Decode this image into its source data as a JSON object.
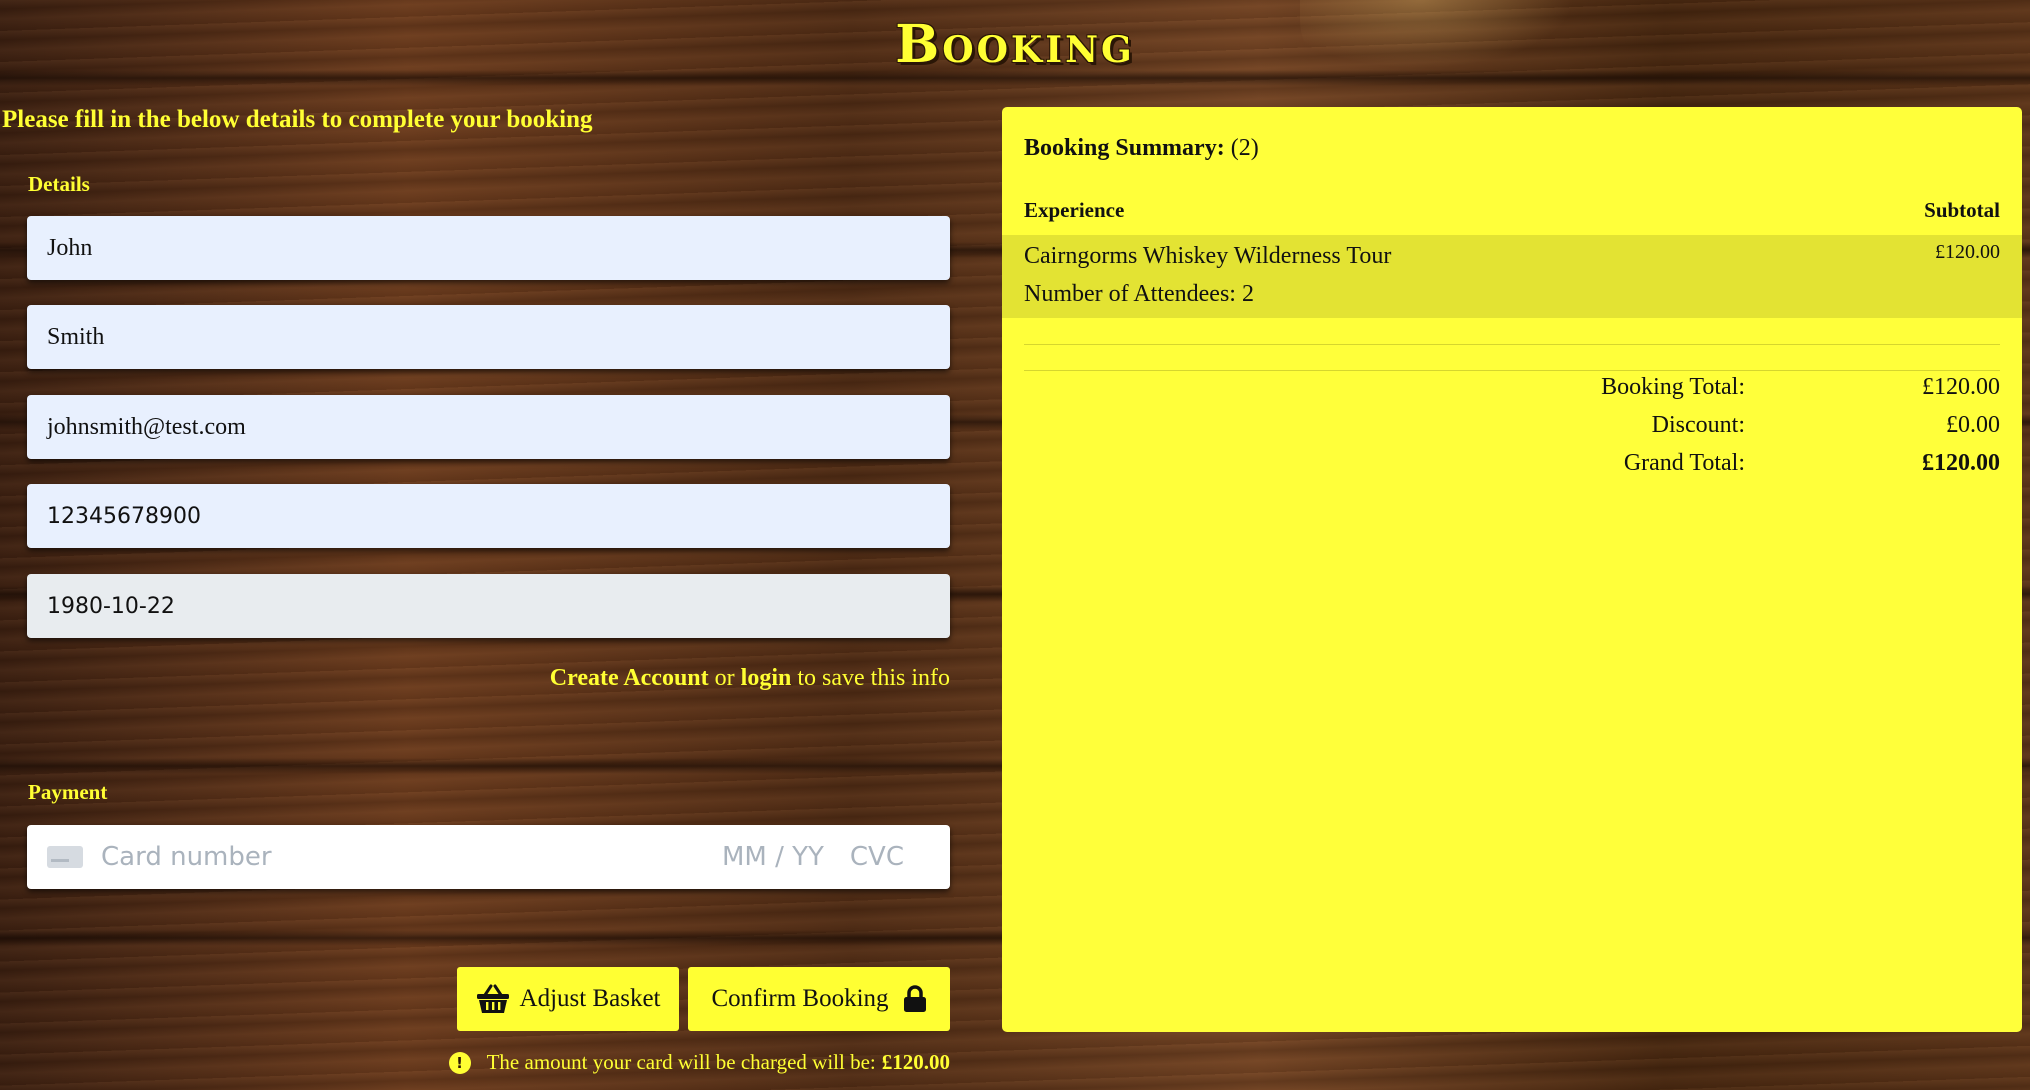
{
  "page": {
    "title": "Booking"
  },
  "intro": "Please fill in the below details to complete your booking",
  "details": {
    "label": "Details",
    "first_name": "John",
    "last_name": "Smith",
    "email": "johnsmith@test.com",
    "phone": "12345678900",
    "dob": "1980-10-22"
  },
  "account": {
    "create": "Create Account",
    "or": "or",
    "login": "login",
    "suffix": "to save this info"
  },
  "payment": {
    "label": "Payment",
    "card_placeholder": "Card number",
    "expiry_placeholder": "MM / YY",
    "cvc_placeholder": "CVC"
  },
  "buttons": {
    "adjust": "Adjust Basket",
    "confirm": "Confirm Booking"
  },
  "charge": {
    "text": "The amount your card will be charged will be:",
    "amount": "£120.00"
  },
  "summary": {
    "title": "Booking Summary:",
    "count": "(2)",
    "col_experience": "Experience",
    "col_subtotal": "Subtotal",
    "item": {
      "name": "Cairngorms Whiskey Wilderness Tour",
      "attendees": "Number of Attendees: 2",
      "price": "£120.00"
    },
    "booking_total_label": "Booking Total:",
    "booking_total": "£120.00",
    "discount_label": "Discount:",
    "discount": "£0.00",
    "grand_total_label": "Grand Total:",
    "grand_total": "£120.00"
  },
  "colors": {
    "accent": "#ffff33",
    "input_bg": "#e8f0fe",
    "summary_bg": "#ffff3a",
    "item_row_bg": "#e3e333"
  },
  "icons": {
    "basket": "basket-icon",
    "lock": "lock-icon",
    "card": "credit-card-icon",
    "warning": "exclamation-circle-icon"
  }
}
